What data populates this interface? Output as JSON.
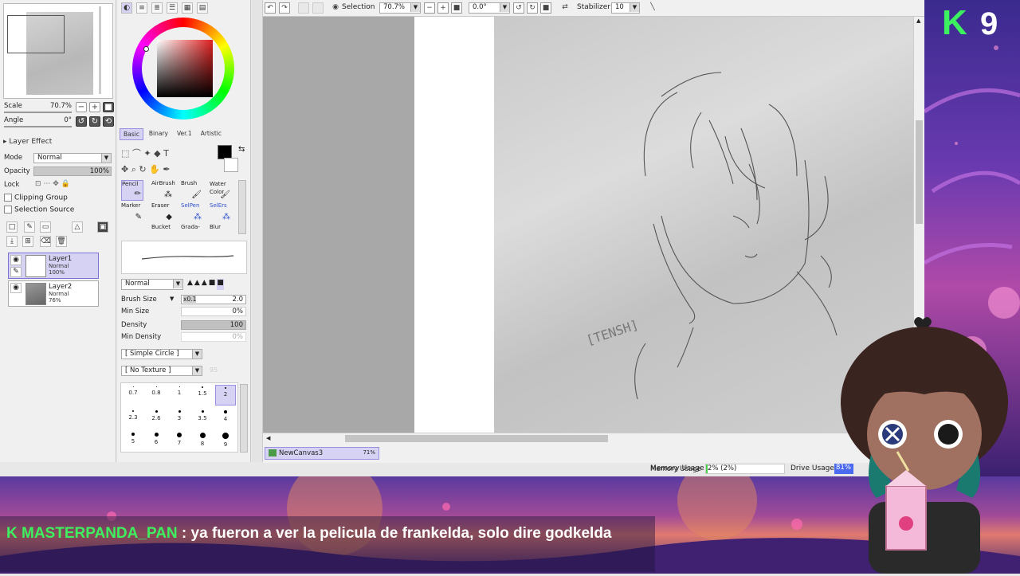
{
  "navigator": {
    "scale_label": "Scale",
    "scale_value": "70.7%",
    "angle_label": "Angle",
    "angle_value": "0°"
  },
  "layer_panel": {
    "section_title": "Layer Effect",
    "mode_label": "Mode",
    "mode_value": "Normal",
    "opacity_label": "Opacity",
    "opacity_value": "100%",
    "lock_label": "Lock",
    "clipping_group": "Clipping Group",
    "selection_source": "Selection Source",
    "layers": [
      {
        "name": "Layer1",
        "mode": "Normal",
        "opacity": "100%",
        "selected": true
      },
      {
        "name": "Layer2",
        "mode": "Normal",
        "opacity": "76%",
        "selected": false
      }
    ]
  },
  "color_panel": {
    "tabs": [
      "Basic",
      "Binary",
      "Ver.1",
      "Artistic"
    ],
    "active_tab": "Basic",
    "current_color": "#000000"
  },
  "tools": {
    "cells": [
      {
        "label": "Pencil",
        "active": true
      },
      {
        "label": "AirBrush"
      },
      {
        "label": "Brush"
      },
      {
        "label": "Water Color"
      },
      {
        "label": "Marker"
      },
      {
        "label": "Eraser"
      },
      {
        "label": "SelPen"
      },
      {
        "label": "SelErs"
      },
      {
        "label": "Bucket"
      },
      {
        "label": "Grada-"
      },
      {
        "label": "Blur"
      }
    ]
  },
  "brush": {
    "blend_mode": "Normal",
    "size_label": "Brush Size",
    "size_mult": "x0.1",
    "size_value": "2.0",
    "min_size_label": "Min Size",
    "min_size_value": "0%",
    "density_label": "Density",
    "density_value": "100",
    "min_density_label": "Min Density",
    "min_density_value": "0%",
    "shape": "[ Simple Circle ]",
    "texture": "[ No Texture ]",
    "texture_value": "95",
    "presets": [
      "0.7",
      "0.8",
      "1",
      "1.5",
      "2",
      "2.3",
      "2.6",
      "3",
      "3.5",
      "4",
      "5",
      "6",
      "7",
      "8",
      "9"
    ]
  },
  "toolbar": {
    "selection_label": "Selection",
    "zoom_value": "70.7%",
    "angle_value": "0.0°",
    "stabilizer_label": "Stabilizer",
    "stabilizer_value": "10"
  },
  "canvas": {
    "tab_name": "NewCanvas3",
    "tab_zoom": "71%",
    "sketch_signature": "[TENSH]"
  },
  "status": {
    "memory_label": "Memory Usage",
    "memory_value": "2% (2%)",
    "drive_label": "Drive Usage",
    "drive_value": "81%"
  },
  "stream": {
    "kick_count": "9",
    "chat_username": "MASTERPANDA_PAN",
    "chat_message": "ya fueron a ver la pelicula de frankelda, solo dire godkelda"
  }
}
